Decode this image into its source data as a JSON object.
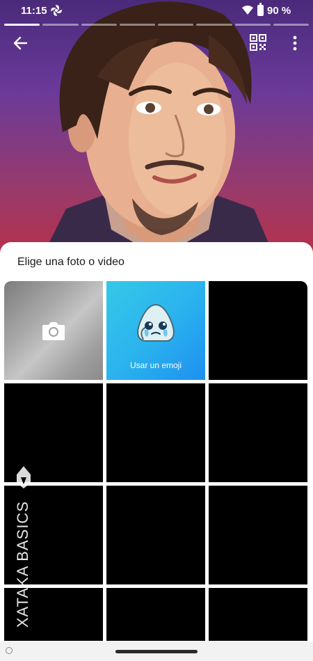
{
  "status_bar": {
    "time": "11:15",
    "battery_percent": "90 %",
    "icons": [
      "fan-icon",
      "wifi-icon",
      "battery-icon"
    ]
  },
  "story": {
    "segments_total": 8,
    "segments_done": 1
  },
  "toolbar": {
    "icons": [
      "back-arrow-icon",
      "qr-code-icon",
      "more-vert-icon"
    ]
  },
  "sheet": {
    "title": "Elige una foto o video",
    "camera_icon": "camera-icon",
    "emoji_label": "Usar un emoji"
  },
  "watermark": {
    "text": "XATAKA BASICS"
  },
  "colors": {
    "sheet_bg": "#ffffff",
    "emoji_tile": "#2bb4ee",
    "tile_empty": "#000000"
  }
}
